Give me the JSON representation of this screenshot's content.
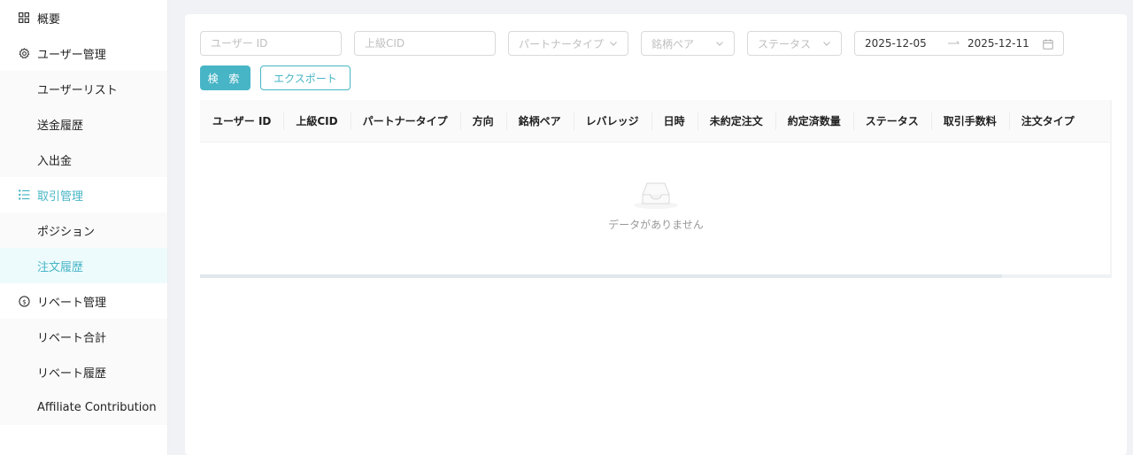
{
  "sidebar": {
    "overview": "概要",
    "user_mgmt": {
      "label": "ユーザー管理",
      "children": [
        "ユーザーリスト",
        "送金履歴",
        "入出金"
      ]
    },
    "trade_mgmt": {
      "label": "取引管理",
      "children": [
        "ポジション",
        "注文履歴"
      ]
    },
    "rebate_mgmt": {
      "label": "リベート管理",
      "children": [
        "リベート合計",
        "リベート履歴",
        "Affiliate Contribution"
      ]
    }
  },
  "filters": {
    "user_id_placeholder": "ユーザー ID",
    "upper_cid_placeholder": "上級CID",
    "partner_type_placeholder": "パートナータイプ",
    "pair_placeholder": "銘柄ペア",
    "status_placeholder": "ステータス",
    "date_start": "2025-12-05",
    "date_end": "2025-12-11"
  },
  "buttons": {
    "search": "検 索",
    "export": "エクスポート"
  },
  "table": {
    "columns": [
      "ユーザー ID",
      "上級CID",
      "パートナータイプ",
      "方向",
      "銘柄ペア",
      "レバレッジ",
      "日時",
      "未約定注文",
      "約定済数量",
      "ステータス",
      "取引手数料",
      "注文タイプ"
    ],
    "empty_text": "データがありません"
  },
  "colors": {
    "accent": "#47b5c6",
    "active_bg": "#eefbfc"
  }
}
